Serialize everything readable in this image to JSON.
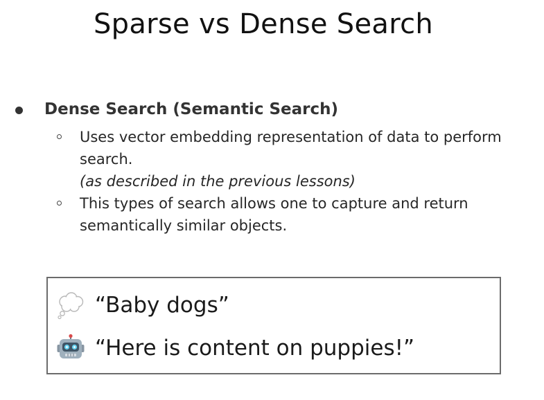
{
  "slide": {
    "title": "Sparse vs Dense Search"
  },
  "bullet": {
    "heading": "Dense Search (Semantic Search)",
    "items": [
      {
        "text": "Uses vector embedding representation of data to perform search.",
        "note": "(as described in the previous lessons)"
      },
      {
        "text": "This types of search allows one to capture and return semantically similar objects."
      }
    ]
  },
  "example": {
    "query": {
      "icon": "thought-bubble-icon",
      "text": "“Baby dogs”"
    },
    "response": {
      "icon": "robot-icon",
      "text": "“Here is content on puppies!”"
    }
  }
}
